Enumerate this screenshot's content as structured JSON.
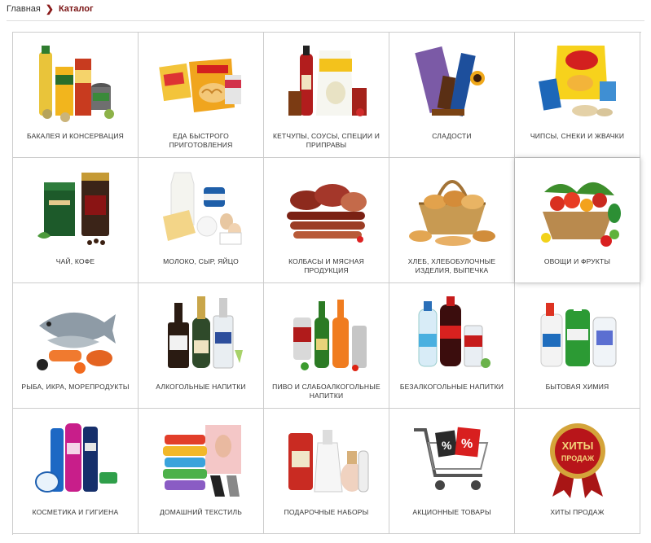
{
  "breadcrumb": {
    "home": "Главная",
    "current": "Каталог"
  },
  "catalog": [
    {
      "label": "БАКАЛЕЯ И КОНСЕРВАЦИЯ",
      "icon": "groceries-icon"
    },
    {
      "label": "ЕДА БЫСТРОГО ПРИГОТОВЛЕНИЯ",
      "icon": "instant-food-icon"
    },
    {
      "label": "КЕТЧУПЫ, СОУСЫ, СПЕЦИИ И ПРИПРАВЫ",
      "icon": "sauces-icon"
    },
    {
      "label": "СЛАДОСТИ",
      "icon": "sweets-icon"
    },
    {
      "label": "ЧИПСЫ, СНЕКИ И ЖВАЧКИ",
      "icon": "chips-icon"
    },
    {
      "label": "ЧАЙ, КОФЕ",
      "icon": "tea-coffee-icon"
    },
    {
      "label": "МОЛОКО, СЫР, ЯЙЦО",
      "icon": "dairy-icon"
    },
    {
      "label": "КОЛБАСЫ И МЯСНАЯ ПРОДУКЦИЯ",
      "icon": "sausages-icon"
    },
    {
      "label": "ХЛЕБ, ХЛЕБОБУЛОЧНЫЕ ИЗДЕЛИЯ, ВЫПЕЧКА",
      "icon": "bread-icon"
    },
    {
      "label": "ОВОЩИ И ФРУКТЫ",
      "icon": "vegetables-fruits-icon"
    },
    {
      "label": "РЫБА, ИКРА, МОРЕПРОДУКТЫ",
      "icon": "fish-icon"
    },
    {
      "label": "АЛКОГОЛЬНЫЕ НАПИТКИ",
      "icon": "alcohol-icon"
    },
    {
      "label": "ПИВО И СЛАБОАЛКОГОЛЬНЫЕ НАПИТКИ",
      "icon": "beer-icon"
    },
    {
      "label": "БЕЗАЛКОГОЛЬНЫЕ НАПИТКИ",
      "icon": "soft-drinks-icon"
    },
    {
      "label": "БЫТОВАЯ ХИМИЯ",
      "icon": "household-chemicals-icon"
    },
    {
      "label": "КОСМЕТИКА И ГИГИЕНА",
      "icon": "cosmetics-icon"
    },
    {
      "label": "ДОМАШНИЙ ТЕКСТИЛЬ",
      "icon": "textile-icon"
    },
    {
      "label": "ПОДАРОЧНЫЕ НАБОРЫ",
      "icon": "gift-sets-icon"
    },
    {
      "label": "АКЦИОННЫЕ ТОВАРЫ",
      "icon": "sale-cart-icon"
    },
    {
      "label": "ХИТЫ ПРОДАЖ",
      "icon": "bestseller-ribbon-icon"
    }
  ],
  "badges": {
    "bestseller_line1": "ХИТЫ",
    "bestseller_line2": "ПРОДАЖ",
    "sale_sign": "%"
  },
  "colors": {
    "accent": "#7a1313",
    "border": "#cccccc"
  }
}
